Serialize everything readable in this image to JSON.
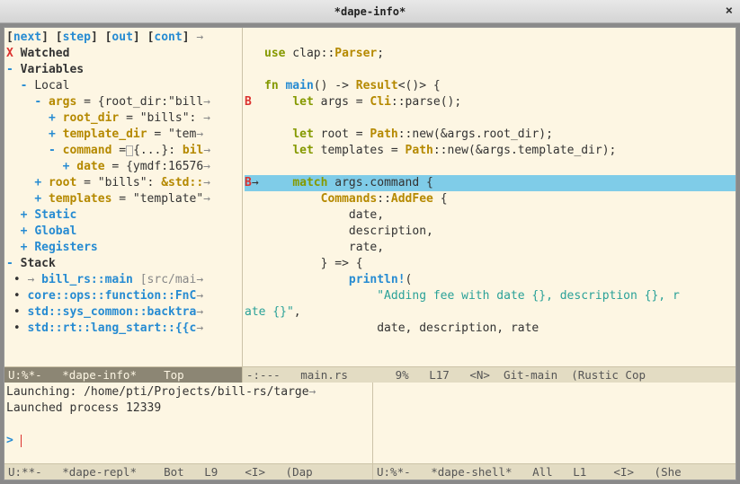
{
  "window": {
    "title": "*dape-info*"
  },
  "dape_info": {
    "buttons": {
      "next": "next",
      "step": "step",
      "out": "out",
      "cont": "cont"
    },
    "watched_marker": "X",
    "watched_label": "Watched",
    "variables_label": "Variables",
    "scopes": {
      "local": "Local",
      "static": "Static",
      "global": "Global",
      "registers": "Registers"
    },
    "vars": {
      "args": "args",
      "args_val": "= {root_dir:\"bill",
      "root_dir": "root_dir",
      "root_dir_val": "= \"bills\": ",
      "template_dir": "template_dir",
      "template_dir_val": "= \"tem",
      "command": "command",
      "command_val": "{...}: ",
      "command_type": "bil",
      "date": "date",
      "date_val": "= {ymdf:16576",
      "root": "root",
      "root_val": "= \"bills\": ",
      "root_type": "&std::",
      "templates": "templates",
      "templates_val": "= \"template\""
    },
    "stack_label": "Stack",
    "frames": [
      {
        "marker": "→",
        "name": "bill_rs::main",
        "loc": "[src/mai"
      },
      {
        "marker": "",
        "name": "core::ops::function::FnC",
        "loc": ""
      },
      {
        "marker": "",
        "name": "std::sys_common::backtra",
        "loc": ""
      },
      {
        "marker": "",
        "name": "std::rt::lang_start::{{c",
        "loc": ""
      }
    ],
    "modeline": "U:%*-   *dape-info*    Top"
  },
  "source": {
    "lines": {
      "l1": "use",
      "l1b": " clap::",
      "l1c": "Parser",
      "l1d": ";",
      "l3a": "fn",
      "l3b": " main",
      "l3c": "() -> ",
      "l3d": "Result",
      "l3e": "<()> {",
      "l4a": "let",
      "l4b": " args = ",
      "l4c": "Cli",
      "l4d": "::parse();",
      "l6a": "let",
      "l6b": " root = ",
      "l6c": "Path",
      "l6d": "::new(&args.root_dir);",
      "l7a": "let",
      "l7b": " templates = ",
      "l7c": "Path",
      "l7d": "::new(&args.template_dir);",
      "l9a": "match",
      "l9b": " args.command {",
      "l10a": "Commands",
      "l10b": "::",
      "l10c": "AddFee",
      "l10d": " {",
      "l11": "date,",
      "l12": "description,",
      "l13": "rate,",
      "l14": "} => {",
      "l15a": "println!",
      "l15b": "(",
      "l16": "\"Adding fee with date {}, description {}, r",
      "l17a": "ate {}\"",
      "l17b": ",",
      "l18": "date, description, rate"
    },
    "bp_marker": "B",
    "arrow_marker": "→",
    "modeline": "-:---   main.rs       9%   L17   <N>  Git-main  (Rustic Cop"
  },
  "repl": {
    "launching": "Launching: /home/pti/Projects/bill-rs/targe",
    "launched": "Launched process 12339",
    "prompt": ">",
    "modeline": "U:**-   *dape-repl*    Bot   L9    <I>   (Dap"
  },
  "shell": {
    "modeline": "U:%*-   *dape-shell*   All   L1    <I>   (She"
  }
}
